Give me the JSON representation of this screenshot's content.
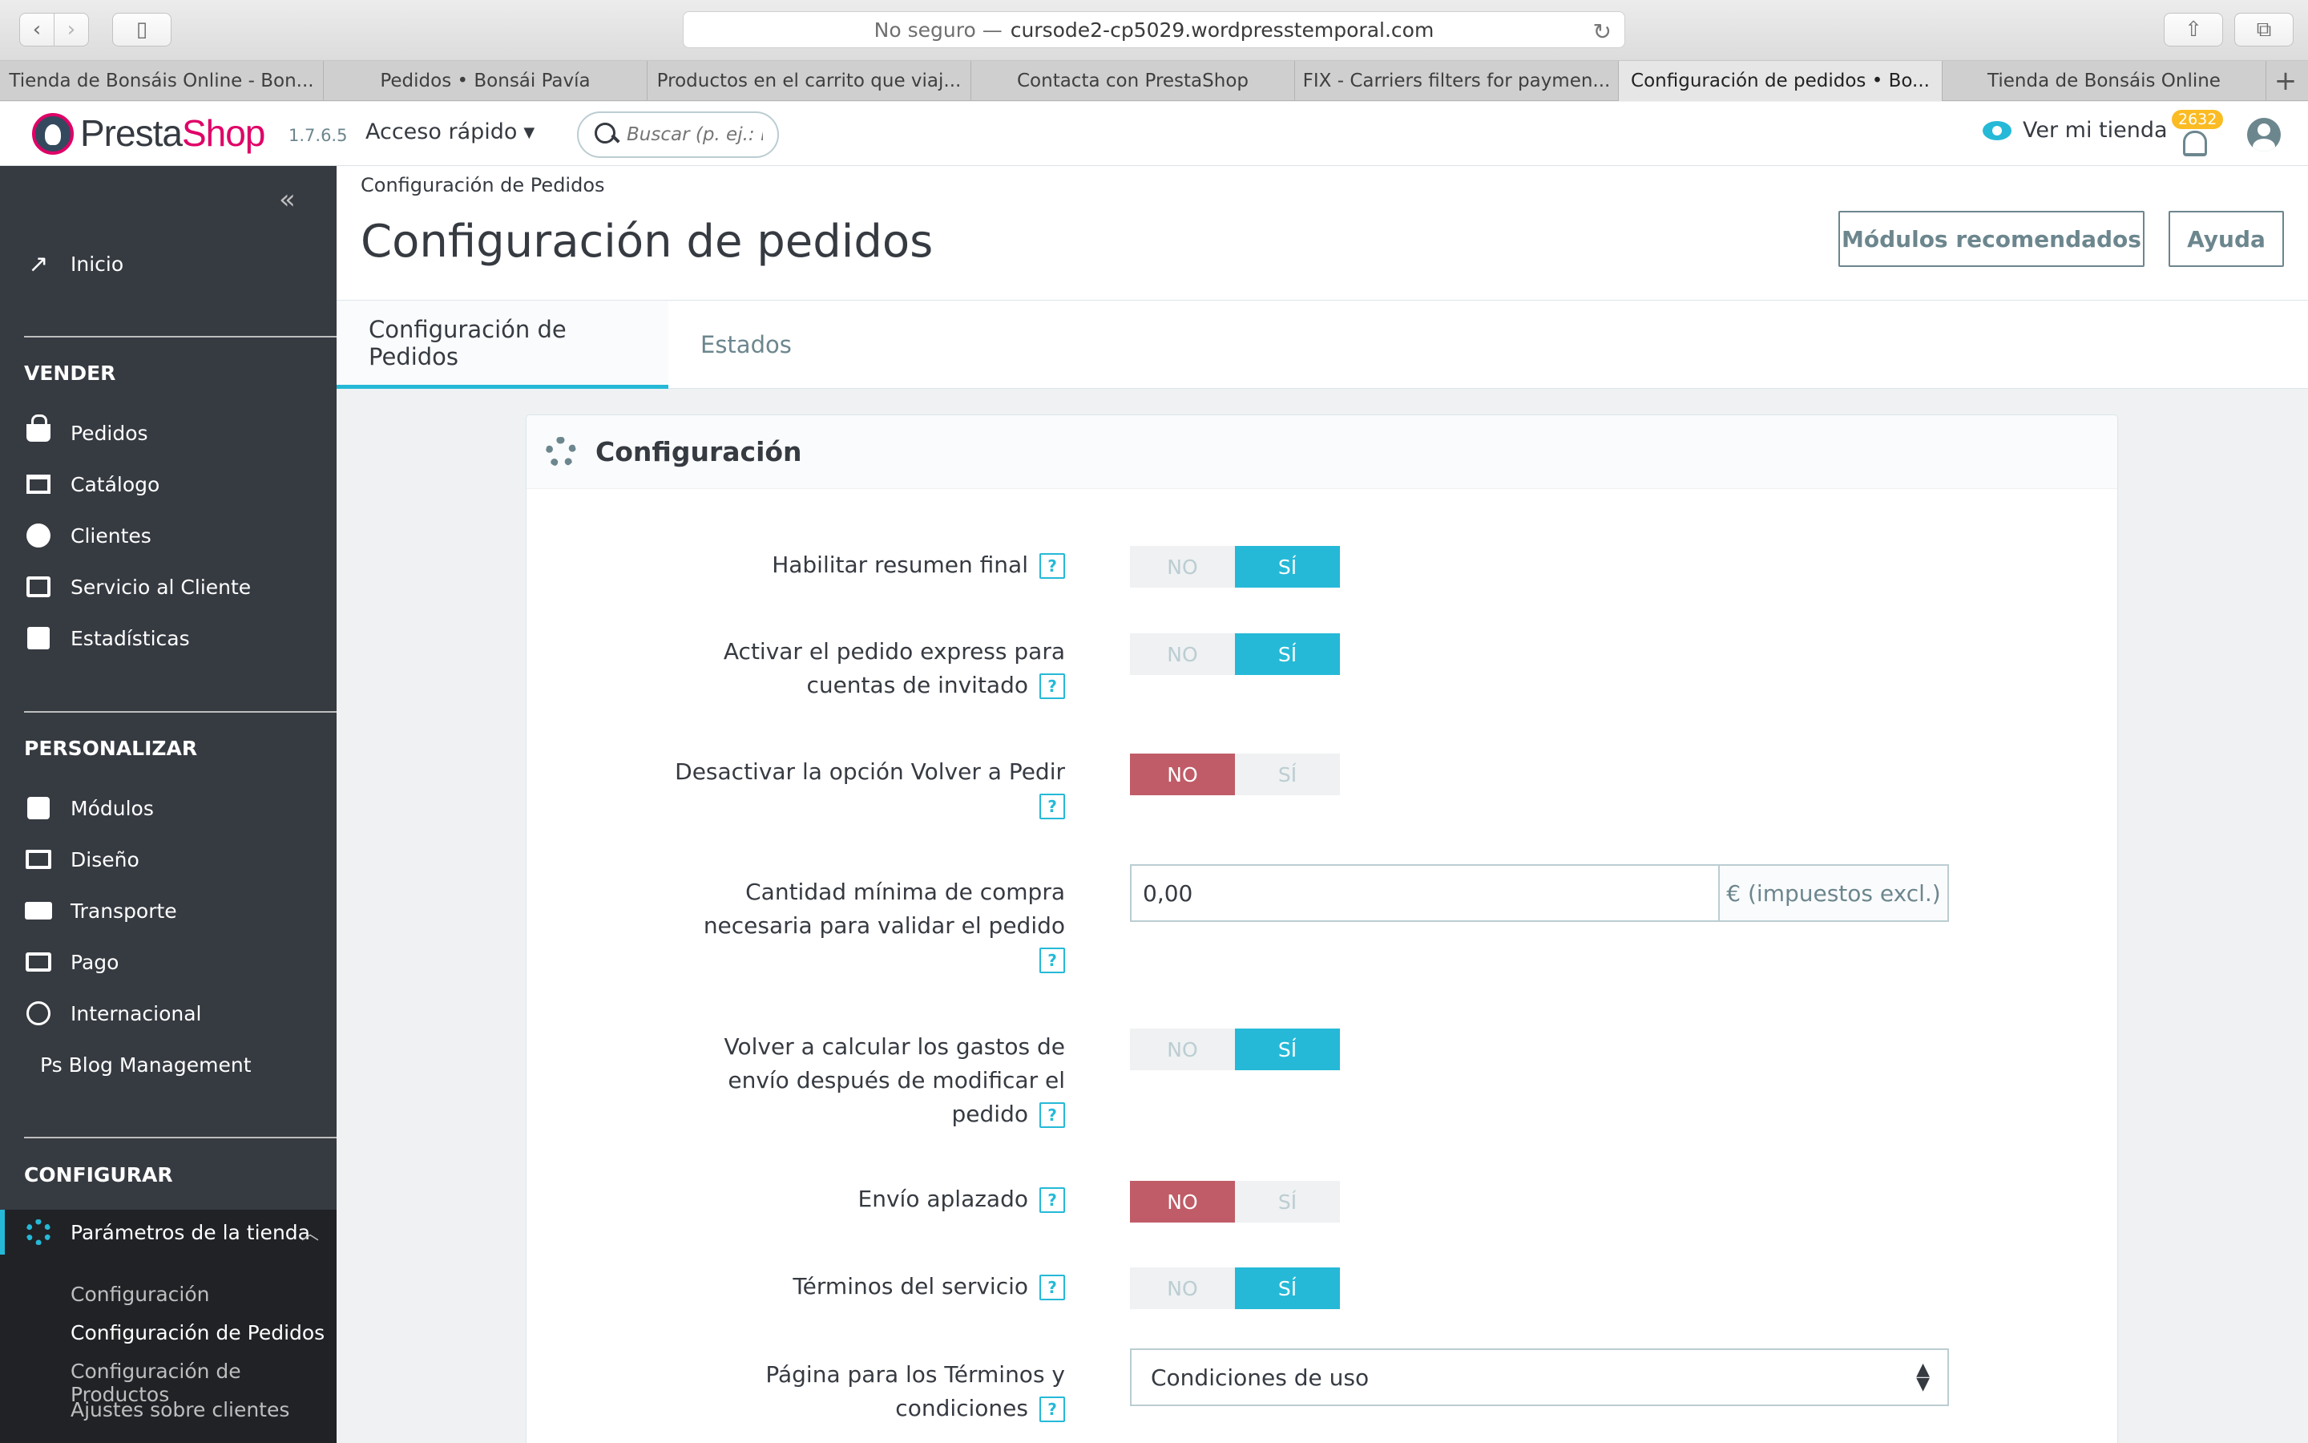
{
  "browser": {
    "insecure_label": "No seguro —",
    "url": "cursode2-cp5029.wordpresstemporal.com",
    "tabs": [
      {
        "label": "Tienda de Bonsáis Online - Bon..."
      },
      {
        "label": "Pedidos • Bonsái Pavía"
      },
      {
        "label": "Productos en el carrito que viaj..."
      },
      {
        "label": "Contacta con PrestaShop"
      },
      {
        "label": "FIX - Carriers filters for paymen..."
      },
      {
        "label": "Configuración de pedidos • Bo..."
      },
      {
        "label": "Tienda de Bonsáis Online"
      }
    ],
    "active_tab_index": 5
  },
  "header": {
    "logo_presta": "Presta",
    "logo_shop": "Shop",
    "version": "1.7.6.5",
    "quick_access": "Acceso rápido",
    "search_placeholder": "Buscar (p. ej.: re",
    "view_store": "Ver mi tienda",
    "notification_count": "2632",
    "colors": {
      "brand_pink": "#df0067",
      "accent": "#25b9d7",
      "badge": "#fbbb22"
    }
  },
  "sidebar": {
    "home": "Inicio",
    "section_sell": "VENDER",
    "sell_items": [
      "Pedidos",
      "Catálogo",
      "Clientes",
      "Servicio al Cliente",
      "Estadísticas"
    ],
    "section_customize": "PERSONALIZAR",
    "customize_items": [
      "Módulos",
      "Diseño",
      "Transporte",
      "Pago",
      "Internacional"
    ],
    "blog": "Ps Blog Management",
    "section_configure": "CONFIGURAR",
    "shop_params": "Parámetros de la tienda",
    "sub_items": [
      "Configuración",
      "Configuración de Pedidos",
      "Configuración de Productos",
      "Ajustes sobre clientes"
    ],
    "current_sub": "Configuración de Pedidos"
  },
  "page": {
    "breadcrumb": "Configuración de Pedidos",
    "title": "Configuración de pedidos",
    "recommended_modules": "Módulos recomendados",
    "help": "Ayuda",
    "tabs": [
      "Configuración de Pedidos",
      "Estados"
    ]
  },
  "panel": {
    "title": "Configuración",
    "help_glyph": "?",
    "toggle_no": "NO",
    "toggle_yes": "SÍ",
    "rows": [
      {
        "label": "Habilitar resumen final",
        "value": "yes"
      },
      {
        "label": "Activar el pedido express para cuentas de invitado",
        "value": "yes"
      },
      {
        "label": "Desactivar la opción Volver a Pedir",
        "value": "no"
      },
      {
        "label": "Cantidad mínima de compra necesaria para validar el pedido",
        "input_value": "0,00",
        "addon": "€ (impuestos excl.)"
      },
      {
        "label": "Volver a calcular los gastos de envío después de modificar el pedido",
        "value": "yes"
      },
      {
        "label": "Envío aplazado",
        "value": "no"
      },
      {
        "label": "Términos del servicio",
        "value": "yes"
      },
      {
        "label": "Página para los Términos y condiciones",
        "select_value": "Condiciones de uso"
      }
    ]
  }
}
